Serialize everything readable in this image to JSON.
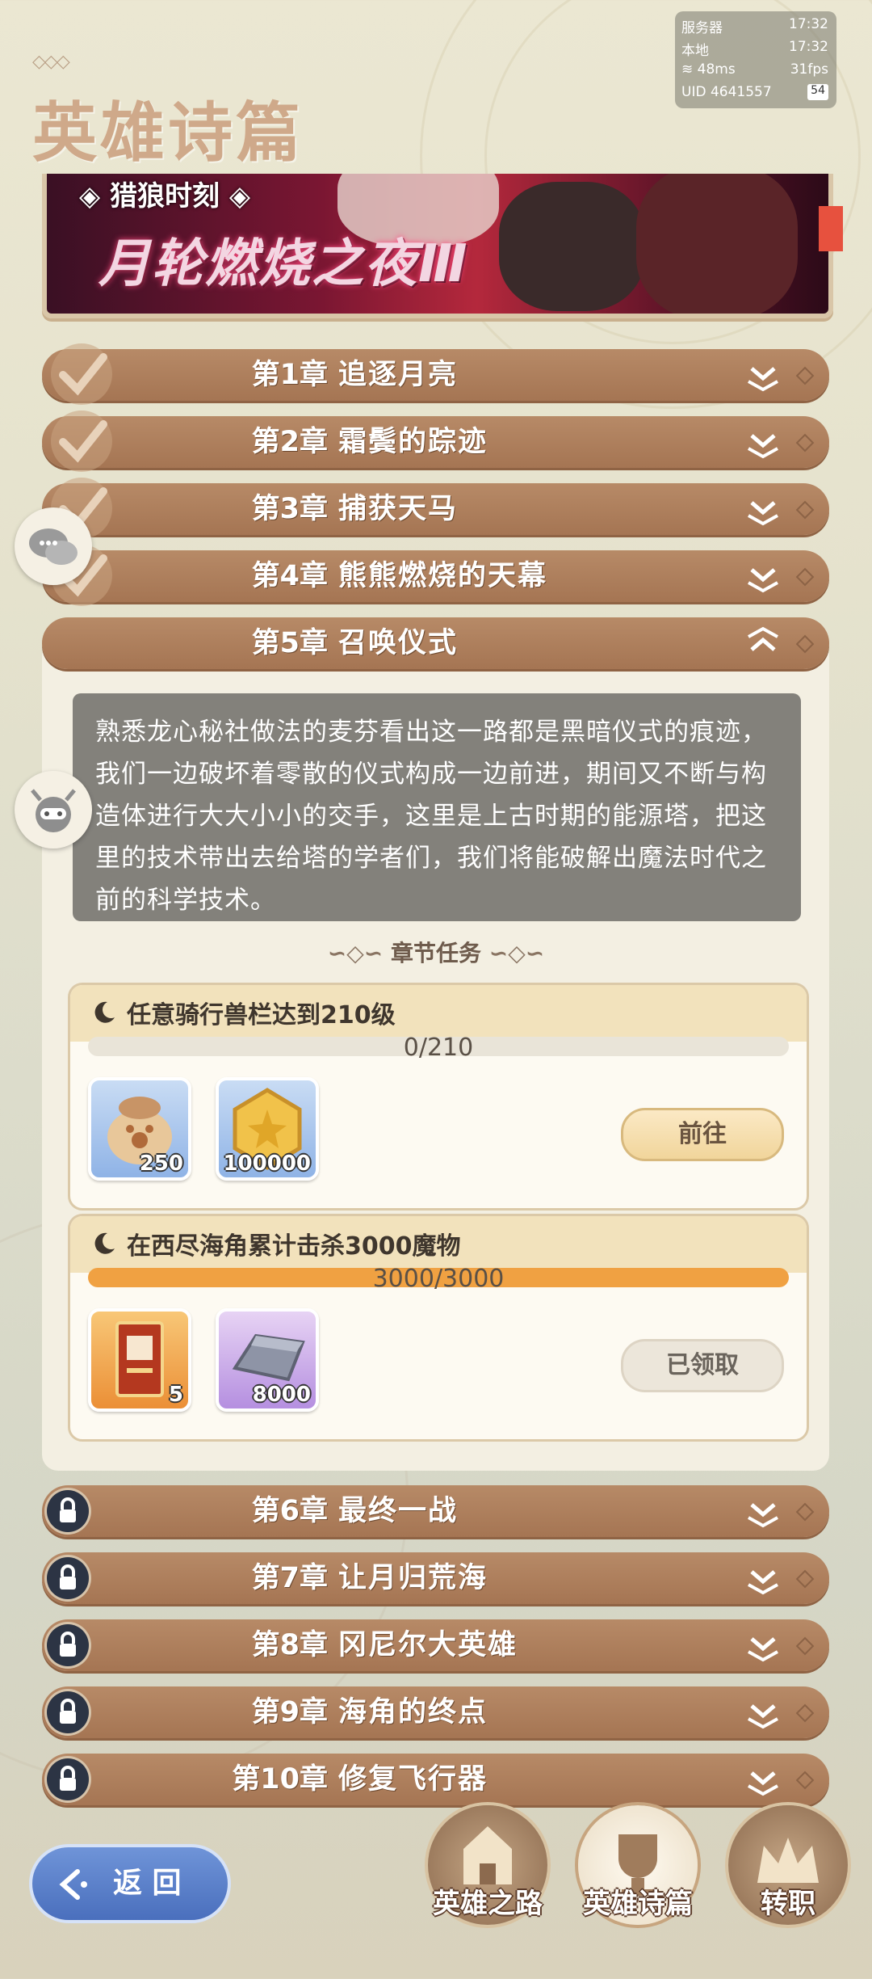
{
  "page": {
    "title": "英雄诗篇"
  },
  "status": {
    "server_label": "服务器",
    "server_time": "17:32",
    "local_label": "本地",
    "local_time": "17:32",
    "ping": "48ms",
    "fps": "31fps",
    "uid": "UID  4641557",
    "battery": "54"
  },
  "banner": {
    "tag": "猎狼时刻",
    "event_title": "月轮燃烧之夜Ⅲ"
  },
  "chapters": [
    {
      "num": "第1章",
      "name": "追逐月亮",
      "state": "done"
    },
    {
      "num": "第2章",
      "name": "霜鬓的踪迹",
      "state": "done"
    },
    {
      "num": "第3章",
      "name": "捕获天马",
      "state": "done"
    },
    {
      "num": "第4章",
      "name": "熊熊燃烧的天幕",
      "state": "done"
    },
    {
      "num": "第5章",
      "name": "召唤仪式",
      "state": "open"
    },
    {
      "num": "第6章",
      "name": "最终一战",
      "state": "locked"
    },
    {
      "num": "第7章",
      "name": "让月归荒海",
      "state": "locked"
    },
    {
      "num": "第8章",
      "name": "冈尼尔大英雄",
      "state": "locked"
    },
    {
      "num": "第9章",
      "name": "海角的终点",
      "state": "locked"
    },
    {
      "num": "第10章",
      "name": "修复飞行器",
      "state": "locked"
    }
  ],
  "chapter5": {
    "description": "熟悉龙心秘社做法的麦芬看出这一路都是黑暗仪式的痕迹，我们一边破坏着零散的仪式构成一边前进，期间又不断与构造体进行大大小小的交手，这里是上古时期的能源塔，把这里的技术带出去给塔的学者们，我们将能破解出魔法时代之前的科学技术。",
    "section_title": "章节任务",
    "tasks": [
      {
        "name": "任意骑行兽栏达到210级",
        "progress_text": "0/210",
        "progress": 0.0,
        "rewards": [
          {
            "icon": "pet-food-bag-icon",
            "qty": "250"
          },
          {
            "icon": "gold-coin-icon",
            "qty": "100000"
          }
        ],
        "button": "前往"
      },
      {
        "name": "在西尽海角累计击杀3000魔物",
        "progress_text": "3000/3000",
        "progress": 1.0,
        "rewards": [
          {
            "icon": "ticket-card-icon",
            "qty": "5"
          },
          {
            "icon": "iron-ingot-icon",
            "qty": "8000"
          }
        ],
        "button": "已领取"
      }
    ]
  },
  "nav": {
    "back": "返 回",
    "tabs": [
      "英雄之路",
      "英雄诗篇",
      "转职"
    ]
  },
  "colors": {
    "accent_brown": "#a97a57",
    "progress_orange": "#f0a142",
    "back_blue": "#5a7fc8"
  }
}
